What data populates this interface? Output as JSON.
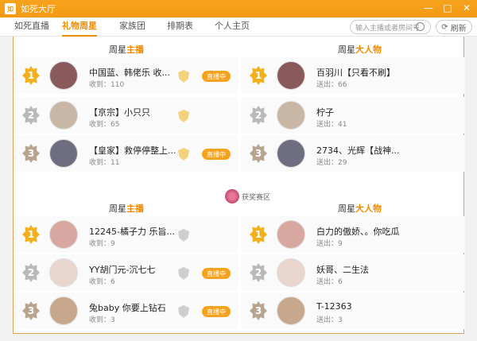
{
  "window": {
    "title": "如死大厅",
    "icon": "app-logo-icon",
    "controls": [
      "—",
      "□",
      "✕"
    ]
  },
  "nav": {
    "tabs": [
      "如死直播",
      "礼物周星",
      "家族团",
      "排期表",
      "个人主页"
    ],
    "active_tab": "礼物周星",
    "search_placeholder": "输入主播或者房间号",
    "refresh_label": "刷新"
  },
  "sections": [
    {
      "title_pre": "周星",
      "title_hl": "主播"
    },
    {
      "title_pre": "周星",
      "title_hl": "大人物"
    },
    {
      "title_pre": "周星",
      "title_hl": "主播"
    },
    {
      "title_pre": "周星",
      "title_hl": "大人物"
    }
  ],
  "divider_badge": "获奖赛区",
  "streamers_top": [
    {
      "rank": "1",
      "name": "中国蓝、韩佬乐 收...",
      "sub": "收到：110",
      "badge": "gold",
      "live": "直播中"
    },
    {
      "rank": "2",
      "name": "【京宗】小只只",
      "sub": "收到：65",
      "badge": "gold",
      "live": ""
    },
    {
      "rank": "3",
      "name": "【皇家】救停停整上...",
      "sub": "收到：11",
      "badge": "gold",
      "live": "直播中"
    }
  ],
  "bigs_top": [
    {
      "rank": "1",
      "name": "百羽川【只看不刷】",
      "sub": "送出：66"
    },
    {
      "rank": "2",
      "name": "柠子",
      "sub": "送出：41"
    },
    {
      "rank": "3",
      "name": "2734、光辉【战神...",
      "sub": "送出：29"
    }
  ],
  "streamers_bottom": [
    {
      "rank": "1",
      "name": "12245-橘子力 乐旨...",
      "sub": "收到：9",
      "badge": "grey",
      "live": ""
    },
    {
      "rank": "2",
      "name": "YY胡门元-沉七七",
      "sub": "收到：6",
      "badge": "grey",
      "live": "直播中"
    },
    {
      "rank": "3",
      "name": "兔baby 你要上钻石",
      "sub": "收到：3",
      "badge": "grey",
      "live": "直播中"
    }
  ],
  "bigs_bottom": [
    {
      "rank": "1",
      "name": "白力的傲娇、。你吃瓜",
      "sub": "送出：9"
    },
    {
      "rank": "2",
      "name": "妖哥、二生法",
      "sub": "送出：6"
    },
    {
      "rank": "3",
      "name": "T-12363",
      "sub": "送出：3"
    }
  ],
  "colors": {
    "accent": "#f08c00",
    "titlebar": "#f39a12",
    "gold": "#f2b11c",
    "silver": "#b9b9b9",
    "bronze": "#b8a48f"
  }
}
